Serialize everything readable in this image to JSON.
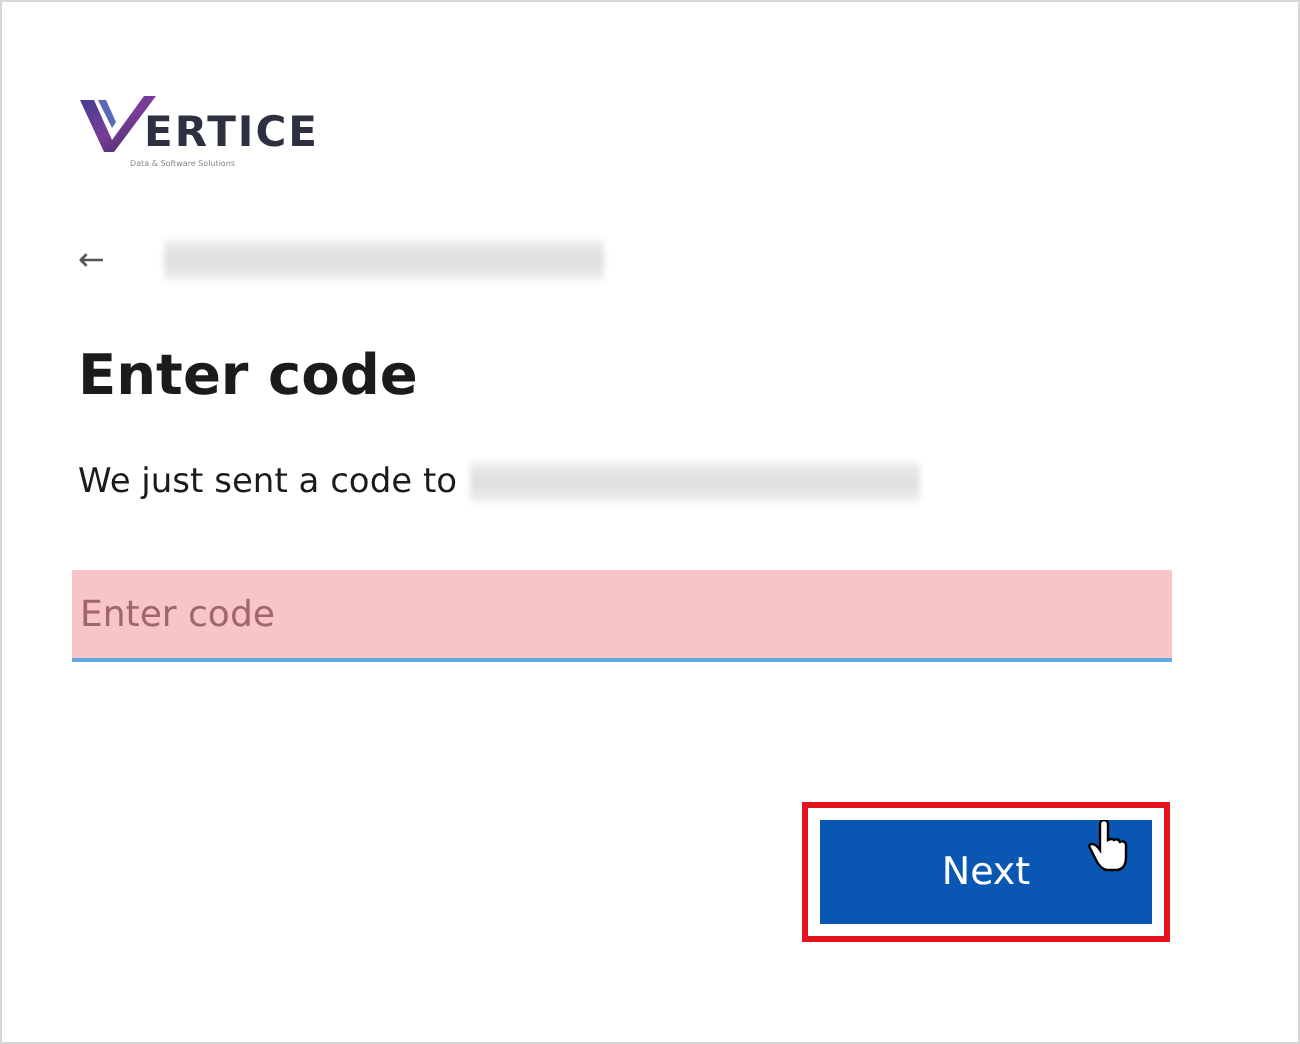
{
  "logo": {
    "wordmark": "ERTICE",
    "tagline": "Data & Software Solutions"
  },
  "identity": {
    "back": "←",
    "redacted": true
  },
  "title": "Enter code",
  "message": {
    "text": "We just sent a code to",
    "redacted": true
  },
  "code_field": {
    "placeholder": "Enter code",
    "highlighted": true
  },
  "next_button": {
    "label": "Next",
    "highlighted": true,
    "hovered": true
  }
}
